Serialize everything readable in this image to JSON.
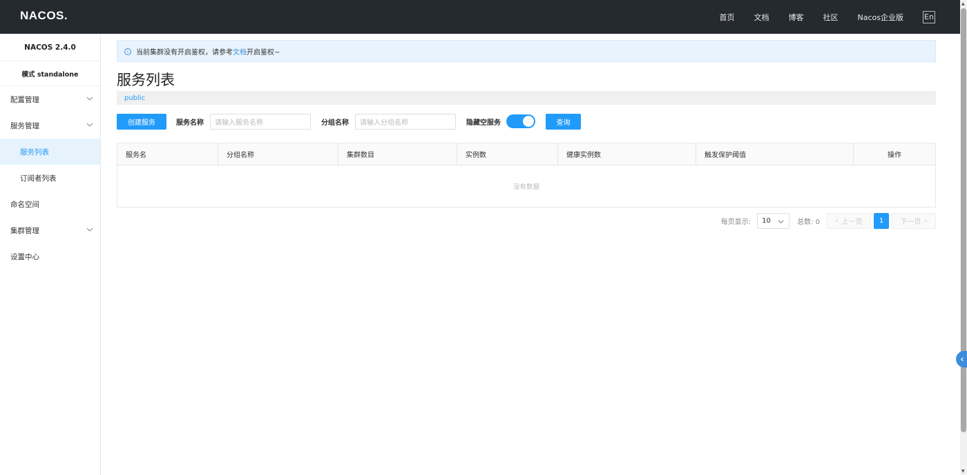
{
  "header": {
    "logo": "NACOS.",
    "nav": [
      "首页",
      "文档",
      "博客",
      "社区",
      "Nacos企业版"
    ],
    "lang": "En"
  },
  "sidebar": {
    "version": "NACOS 2.4.0",
    "mode": "模式 standalone",
    "items": [
      {
        "label": "配置管理",
        "expandable": true
      },
      {
        "label": "服务管理",
        "expandable": true
      },
      {
        "label": "服务列表",
        "sub": true,
        "active": true
      },
      {
        "label": "订阅者列表",
        "sub": true
      },
      {
        "label": "命名空间"
      },
      {
        "label": "集群管理",
        "expandable": true
      },
      {
        "label": "设置中心"
      }
    ]
  },
  "notice": {
    "prefix": "当前集群没有开启鉴权，请参考",
    "link": "文档",
    "suffix": "开启鉴权~"
  },
  "page": {
    "title": "服务列表",
    "namespace": "public"
  },
  "toolbar": {
    "create": "创建服务",
    "service_name_label": "服务名称",
    "service_name_placeholder": "请输入服务名称",
    "group_name_label": "分组名称",
    "group_name_placeholder": "请输入分组名称",
    "hide_empty_label": "隐藏空服务",
    "hide_empty_on": true,
    "query": "查询"
  },
  "table": {
    "columns": [
      "服务名",
      "分组名称",
      "集群数目",
      "实例数",
      "健康实例数",
      "触发保护阈值",
      "操作"
    ],
    "empty": "没有数据"
  },
  "pager": {
    "page_size_label": "每页显示:",
    "page_size": "10",
    "total_label": "总数: 0",
    "prev": "上一页",
    "current": "1",
    "next": "下一页"
  },
  "colors": {
    "accent": "#209bfa",
    "header_bg": "#252a2f"
  }
}
